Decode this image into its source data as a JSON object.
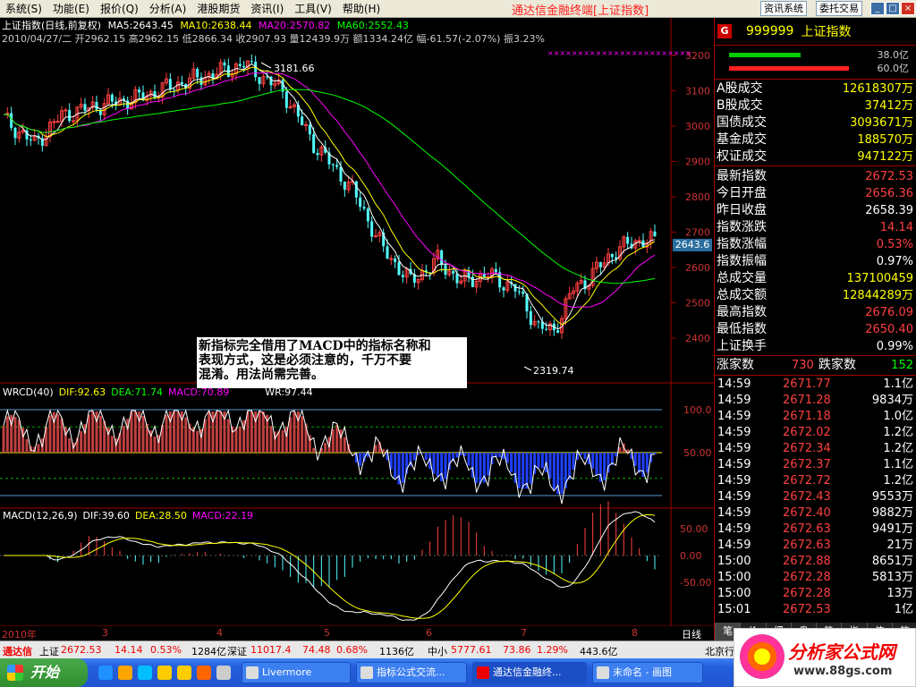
{
  "menubar": {
    "items": [
      "系统(S)",
      "功能(E)",
      "报价(Q)",
      "分析(A)",
      "港股期货",
      "资讯(I)",
      "工具(V)",
      "帮助(H)"
    ],
    "title": "通达信金融终端[上证指数]",
    "btn_news": "资讯系统",
    "btn_trade": "委托交易"
  },
  "main": {
    "header": "上证指数(日线,前复权)",
    "ma5": "MA5:2643.45",
    "ma10": "MA10:2638.44",
    "ma20": "MA20:2570.82",
    "ma60": "MA60:2552.43",
    "ohlc": "2010/04/27/二 开2962.15 高2962.15 低2866.34 收2907.93 量12439.9万 额1334.24亿 幅-61.57(-2.07%) 振3.23%",
    "high_label": "3181.66",
    "low_label": "2319.74",
    "current_price": "2643.6",
    "yticks": [
      "3200",
      "3100",
      "3000",
      "2900",
      "2800",
      "2700",
      "2600",
      "2500",
      "2400"
    ],
    "colors": {
      "ma5": "#ffffff",
      "ma10": "#ffff00",
      "ma20": "#ff00ff",
      "ma60": "#00ff00",
      "up": "#ff4040",
      "down": "#54ffff"
    }
  },
  "wrcd": {
    "title": "WRCD(40)",
    "dif": "DIF:92.63",
    "dea": "DEA:71.74",
    "macd": "MACD:70.89",
    "wr": "WR:97.44",
    "yticks": [
      "100.0",
      "50.00"
    ]
  },
  "macd": {
    "title": "MACD(12,26,9)",
    "dif": "DIF:39.60",
    "dea": "DEA:28.50",
    "macd": "MACD:22.19",
    "yticks": [
      "50.00",
      "0.00",
      "-50.00"
    ]
  },
  "tooltip": {
    "line1": "新指标完全借用了MACD中的指标名称和",
    "line2": "表现方式，这是必须注意的，千万不要",
    "line3": "混淆。用法尚需完善。"
  },
  "date_axis": {
    "labels": [
      "2010年",
      "3",
      "4",
      "5",
      "6",
      "7",
      "8"
    ],
    "period": "日线"
  },
  "right_panel": {
    "badge": "G",
    "code": "999999",
    "name": "上证指数",
    "rate_up": "38.0亿",
    "rate_down": "60.0亿",
    "volumes": [
      {
        "label": "A股成交",
        "value": "12618307万"
      },
      {
        "label": "B股成交",
        "value": "37412万"
      },
      {
        "label": "国债成交",
        "value": "3093671万"
      },
      {
        "label": "基金成交",
        "value": "188570万"
      },
      {
        "label": "权证成交",
        "value": "947122万"
      }
    ],
    "stats": [
      {
        "label": "最新指数",
        "value": "2672.53",
        "color": "#ff4040"
      },
      {
        "label": "今日开盘",
        "value": "2656.36",
        "color": "#ff4040"
      },
      {
        "label": "昨日收盘",
        "value": "2658.39",
        "color": "#ffffff"
      },
      {
        "label": "指数涨跌",
        "value": "14.14",
        "color": "#ff4040"
      },
      {
        "label": "指数涨幅",
        "value": "0.53%",
        "color": "#ff4040"
      },
      {
        "label": "指数振幅",
        "value": "0.97%",
        "color": "#ffffff"
      },
      {
        "label": "总成交量",
        "value": "137100459",
        "color": "#ffff00"
      },
      {
        "label": "总成交额",
        "value": "12844289万",
        "color": "#ffff00"
      },
      {
        "label": "最高指数",
        "value": "2676.09",
        "color": "#ff4040"
      },
      {
        "label": "最低指数",
        "value": "2650.40",
        "color": "#ff4040"
      },
      {
        "label": "上证换手",
        "value": "0.99%",
        "color": "#ffffff"
      }
    ],
    "adv_label": "涨家数",
    "adv_value": "730",
    "dec_label": "跌家数",
    "dec_value": "152",
    "ticks": [
      {
        "t": "14:59",
        "p": "2671.77",
        "q": "1.1亿"
      },
      {
        "t": "14:59",
        "p": "2671.28",
        "q": "9834万"
      },
      {
        "t": "14:59",
        "p": "2671.18",
        "q": "1.0亿"
      },
      {
        "t": "14:59",
        "p": "2672.02",
        "q": "1.2亿"
      },
      {
        "t": "14:59",
        "p": "2672.34",
        "q": "1.2亿"
      },
      {
        "t": "14:59",
        "p": "2672.37",
        "q": "1.1亿"
      },
      {
        "t": "14:59",
        "p": "2672.72",
        "q": "1.2亿"
      },
      {
        "t": "14:59",
        "p": "2672.43",
        "q": "9553万"
      },
      {
        "t": "14:59",
        "p": "2672.40",
        "q": "9882万"
      },
      {
        "t": "14:59",
        "p": "2672.63",
        "q": "9491万"
      },
      {
        "t": "14:59",
        "p": "2672.63",
        "q": "21万"
      },
      {
        "t": "15:00",
        "p": "2672.88",
        "q": "8651万"
      },
      {
        "t": "15:00",
        "p": "2672.28",
        "q": "5813万"
      },
      {
        "t": "15:00",
        "p": "2672.28",
        "q": "13万"
      },
      {
        "t": "15:01",
        "p": "2672.53",
        "q": "1亿"
      }
    ],
    "tabs": [
      "笔",
      "价",
      "细",
      "盘",
      "势",
      "指",
      "值",
      "筹"
    ]
  },
  "statusbar": {
    "brand": "通达信",
    "sh_label": "上证",
    "sh_price": "2672.53",
    "sh_chg": "14.14",
    "sh_pct": "0.53%",
    "sh_amt": "1284亿",
    "sz_label": "深证",
    "sz_price": "11017.4",
    "sz_chg": "74.48",
    "sz_pct": "0.68%",
    "sz_amt": "1136亿",
    "zx_label": "中小",
    "zx_price": "5777.61",
    "zx_chg": "73.86",
    "zx_pct": "1.29%",
    "zx_amt": "443.6亿",
    "region": "北京行"
  },
  "taskbar": {
    "start": "开始",
    "tasks": [
      "Livermore",
      "指标公式交流...",
      "通达信金融终...",
      "未命名 - 画图"
    ]
  },
  "logo": {
    "title": "分析家公式网",
    "url": "www.88gs.com"
  }
}
